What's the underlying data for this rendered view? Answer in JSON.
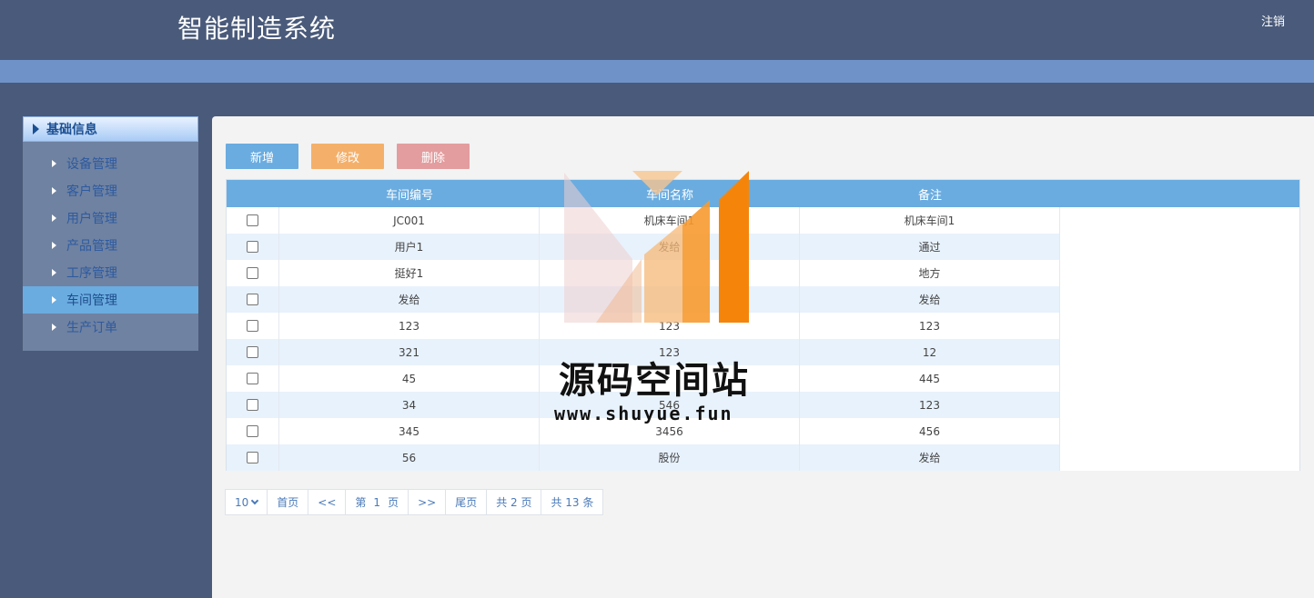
{
  "header": {
    "title": "智能制造系统",
    "logout_label": "注销"
  },
  "sidebar": {
    "group_label": "基础信息",
    "items": [
      {
        "label": "设备管理",
        "active": false
      },
      {
        "label": "客户管理",
        "active": false
      },
      {
        "label": "用户管理",
        "active": false
      },
      {
        "label": "产品管理",
        "active": false
      },
      {
        "label": "工序管理",
        "active": false
      },
      {
        "label": "车间管理",
        "active": true
      },
      {
        "label": "生产订单",
        "active": false
      }
    ]
  },
  "toolbar": {
    "add_label": "新增",
    "edit_label": "修改",
    "delete_label": "删除"
  },
  "table": {
    "columns": [
      "车间编号",
      "车间名称",
      "备注"
    ],
    "rows": [
      [
        "JC001",
        "机床车间1",
        "机床车间1"
      ],
      [
        "用户1",
        "发给",
        "通过"
      ],
      [
        "挺好1",
        "",
        "地方"
      ],
      [
        "发给",
        "",
        "发给"
      ],
      [
        "123",
        "123",
        "123"
      ],
      [
        "321",
        "123",
        "12"
      ],
      [
        "45",
        "",
        "445"
      ],
      [
        "34",
        "546",
        "123"
      ],
      [
        "345",
        "3456",
        "456"
      ],
      [
        "56",
        "股份",
        "发给"
      ]
    ]
  },
  "pager": {
    "page_size": "10",
    "first": "首页",
    "prev": "<<",
    "page_prefix": "第",
    "page_num": "1",
    "page_suffix": "页",
    "next": ">>",
    "last": "尾页",
    "total_pages": "共 2 页",
    "total_records": "共 13 条"
  },
  "watermark": {
    "name": "源码空间站",
    "url": "www.shuyue.fun"
  },
  "colors": {
    "header_bg": "#4a5a7a",
    "subbar_bg": "#6f93c9",
    "accent_blue": "#6aace0",
    "edit_orange": "#f4b06a",
    "delete_pink": "#e39d9f"
  }
}
